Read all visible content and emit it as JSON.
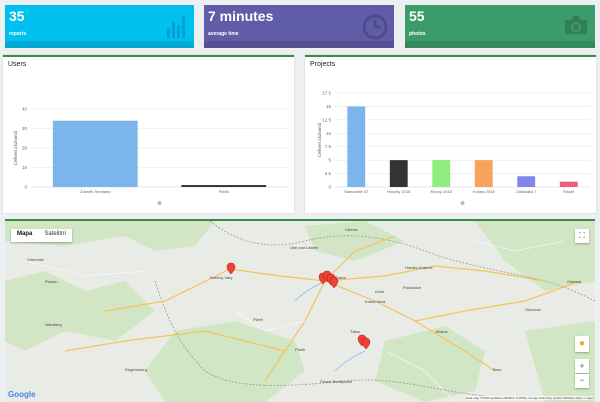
{
  "stats": [
    {
      "value": "35",
      "label": "reports",
      "icon": "bar-chart-icon",
      "color": "#00c0ef"
    },
    {
      "value": "7 minutes",
      "label": "average time",
      "icon": "clock-icon",
      "color": "#605ca8"
    },
    {
      "value": "55",
      "label": "photos",
      "icon": "camera-icon",
      "color": "#3c9b6b"
    }
  ],
  "users_card": {
    "title": "Users"
  },
  "projects_card": {
    "title": "Projects"
  },
  "chart_data": [
    {
      "type": "bar",
      "title": "Users",
      "ylabel": "Celkem záznamů",
      "categories": [
        "Zdeněk Smetana",
        "Patrik"
      ],
      "values": [
        34,
        1
      ],
      "ylim": [
        0,
        40
      ],
      "yticks": [
        "0",
        "10",
        "20",
        "30",
        "40"
      ],
      "colors": [
        "#7cb5ec",
        "#333333"
      ],
      "grid": true
    },
    {
      "type": "bar",
      "title": "Projects",
      "ylabel": "Celkem záznamů",
      "categories": [
        "Stanoviště 37",
        "Hvozdy 2018",
        "Kbony 2018",
        "Kuřata 2018",
        "Záhrádka 7",
        "Šnažé"
      ],
      "values": [
        15,
        5,
        5,
        5,
        2,
        1
      ],
      "ylim": [
        0,
        17.5
      ],
      "yticks": [
        "0",
        "2.5",
        "5",
        "7.5",
        "10",
        "12.5",
        "15",
        "17.5"
      ],
      "colors": [
        "#7cb5ec",
        "#333333",
        "#90ed7d",
        "#f7a35c",
        "#8085e9",
        "#f15c80"
      ],
      "grid": true
    }
  ],
  "map": {
    "tab_map": "Mapa",
    "tab_satellite": "Satelitní",
    "attribution": "Data map ©2018 GeoBasis-DE/BKG (©2009), Google   Podmínky použití   Nahlásit chybu v mapě",
    "logo": "Google",
    "cities": [
      "Chemnitz",
      "Plauen",
      "Karlovy Vary",
      "Praha",
      "Kolín",
      "Hradec Králové",
      "Pardubice",
      "Plzeň",
      "Jihlava",
      "Brno",
      "Olomouc",
      "Ostrava",
      "Regensburg",
      "Nürnberg",
      "Ústí nad Labem",
      "Liberec",
      "České Budějovice",
      "Tábor",
      "Písek",
      "Kutná Hora"
    ]
  }
}
